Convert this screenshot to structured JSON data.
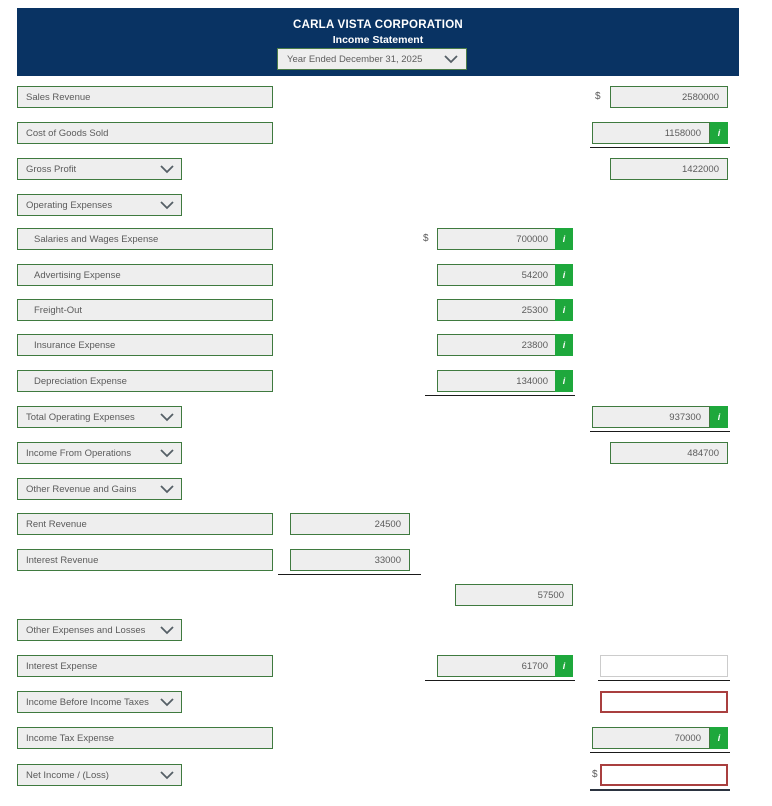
{
  "header": {
    "company": "CARLA VISTA CORPORATION",
    "statement_title": "Income Statement",
    "period_value": "Year Ended December 31, 2025",
    "period_icon": "chevron-down-icon",
    "background_color": "#093363"
  },
  "colors": {
    "banner_navy": "#093363",
    "field_border_green": "#3f7a3f",
    "field_fill": "#eeeeee",
    "info_badge_green": "#1ea83c",
    "error_border_red": "#a93f3f",
    "text_gray": "#5b5b5b"
  },
  "symbols": {
    "dollar": "$",
    "info": "i"
  },
  "rows": [
    {
      "label": "Sales Revenue",
      "type": "input",
      "indent": false,
      "right_value": "2580000",
      "right_dollar": true,
      "right_badge": false
    },
    {
      "label": "Cost of Goods Sold",
      "type": "input",
      "indent": false,
      "right_value": "1158000",
      "right_dollar": false,
      "right_badge": true,
      "rule_after": "right"
    },
    {
      "label": "Gross Profit",
      "type": "select",
      "indent": false,
      "right_value": "1422000",
      "right_dollar": false,
      "right_badge": false
    },
    {
      "label": "Operating Expenses",
      "type": "select",
      "indent": false
    },
    {
      "label": "Salaries and Wages Expense",
      "type": "input",
      "indent": true,
      "mid_value": "700000",
      "mid_dollar": true,
      "mid_badge": true
    },
    {
      "label": "Advertising Expense",
      "type": "input",
      "indent": true,
      "mid_value": "54200",
      "mid_dollar": false,
      "mid_badge": true
    },
    {
      "label": "Freight-Out",
      "type": "input",
      "indent": true,
      "mid_value": "25300",
      "mid_dollar": false,
      "mid_badge": true
    },
    {
      "label": "Insurance Expense",
      "type": "input",
      "indent": true,
      "mid_value": "23800",
      "mid_dollar": false,
      "mid_badge": true
    },
    {
      "label": "Depreciation Expense",
      "type": "input",
      "indent": true,
      "mid_value": "134000",
      "mid_dollar": false,
      "mid_badge": true,
      "rule_after": "mid"
    },
    {
      "label": "Total Operating Expenses",
      "type": "select",
      "indent": false,
      "right_value": "937300",
      "right_dollar": false,
      "right_badge": true,
      "rule_after": "right"
    },
    {
      "label": "Income From Operations",
      "type": "select",
      "indent": false,
      "right_value": "484700",
      "right_dollar": false,
      "right_badge": false
    },
    {
      "label": "Other Revenue and Gains",
      "type": "select",
      "indent": false
    },
    {
      "label": "Rent Revenue",
      "type": "input",
      "indent": false,
      "narrow_value": "24500"
    },
    {
      "label": "Interest Revenue",
      "type": "input",
      "indent": false,
      "narrow_value": "33000",
      "rule_after": "narrow"
    },
    {
      "label": "",
      "type": "none",
      "mid2_value": "57500"
    },
    {
      "label": "Other Expenses and Losses",
      "type": "select",
      "indent": false
    },
    {
      "label": "Interest Expense",
      "type": "input",
      "indent": false,
      "mid_value": "61700",
      "mid_badge": true,
      "right_empty": "gray",
      "rule_after": "mid-and-right"
    },
    {
      "label": "Income Before Income Taxes",
      "type": "select",
      "indent": false,
      "right_empty": "red"
    },
    {
      "label": "Income Tax Expense",
      "type": "input",
      "indent": false,
      "right_value": "70000",
      "right_badge": true,
      "rule_after": "right"
    },
    {
      "label": "Net Income / (Loss)",
      "type": "select",
      "indent": false,
      "right_empty": "red",
      "right_dollar": true,
      "rule_after": "right-thick"
    }
  ]
}
